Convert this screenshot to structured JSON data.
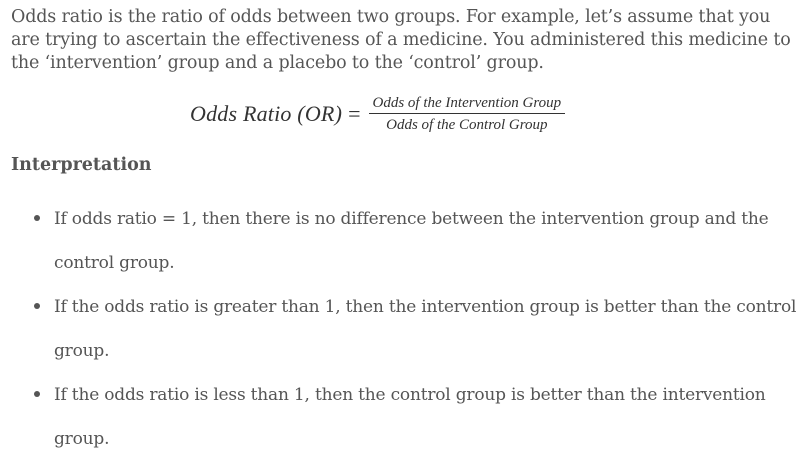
{
  "intro": "Odds ratio is the ratio of odds between two groups. For example, let’s assume that you are trying to ascertain the effectiveness of a medicine. You administered this medicine to the ‘intervention’ group and a placebo to the ‘control’ group.",
  "formula": {
    "lhs": "Odds Ratio (OR)",
    "equals": "=",
    "numerator": "Odds of the Intervention Group",
    "denominator": "Odds of the Control Group"
  },
  "heading": "Interpretation",
  "bullets": [
    "If odds ratio = 1, then there is no difference between the intervention group and the control group.",
    "If the odds ratio is greater than 1, then the intervention group is better than the control group.",
    "If the odds ratio is less than 1, then the control group is better than the intervention group."
  ]
}
